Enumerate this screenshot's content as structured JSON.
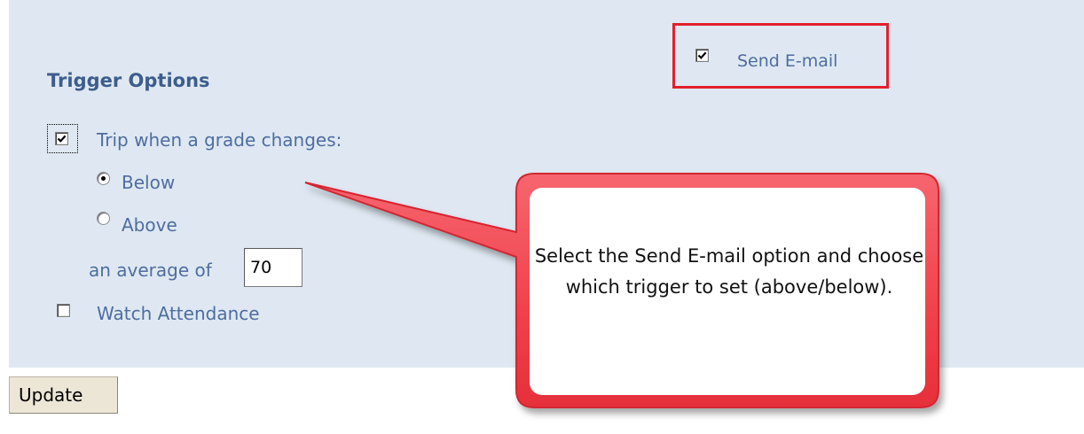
{
  "trigger_section": {
    "title": "Trigger Options"
  },
  "send_email": {
    "label": "Send E-mail",
    "checked": true,
    "highlight_color": "#e3202c"
  },
  "grade_trigger": {
    "label": "Trip when a grade changes:",
    "checked": true,
    "options": [
      {
        "label": "Below",
        "selected": true
      },
      {
        "label": "Above",
        "selected": false
      }
    ],
    "average_label": "an average of",
    "average_value": "70"
  },
  "attendance": {
    "label": "Watch Attendance",
    "checked": false
  },
  "update_button": {
    "label": "Update"
  },
  "callout": {
    "text": "Select the Send E-mail option and choose which trigger to set (above/below).",
    "fill_color": "#f0444e",
    "border_color": "#e12a34"
  },
  "colors": {
    "panel_background": "#dfe8f2",
    "label_text": "#4e6da0",
    "title_text": "#3d5d8c"
  }
}
